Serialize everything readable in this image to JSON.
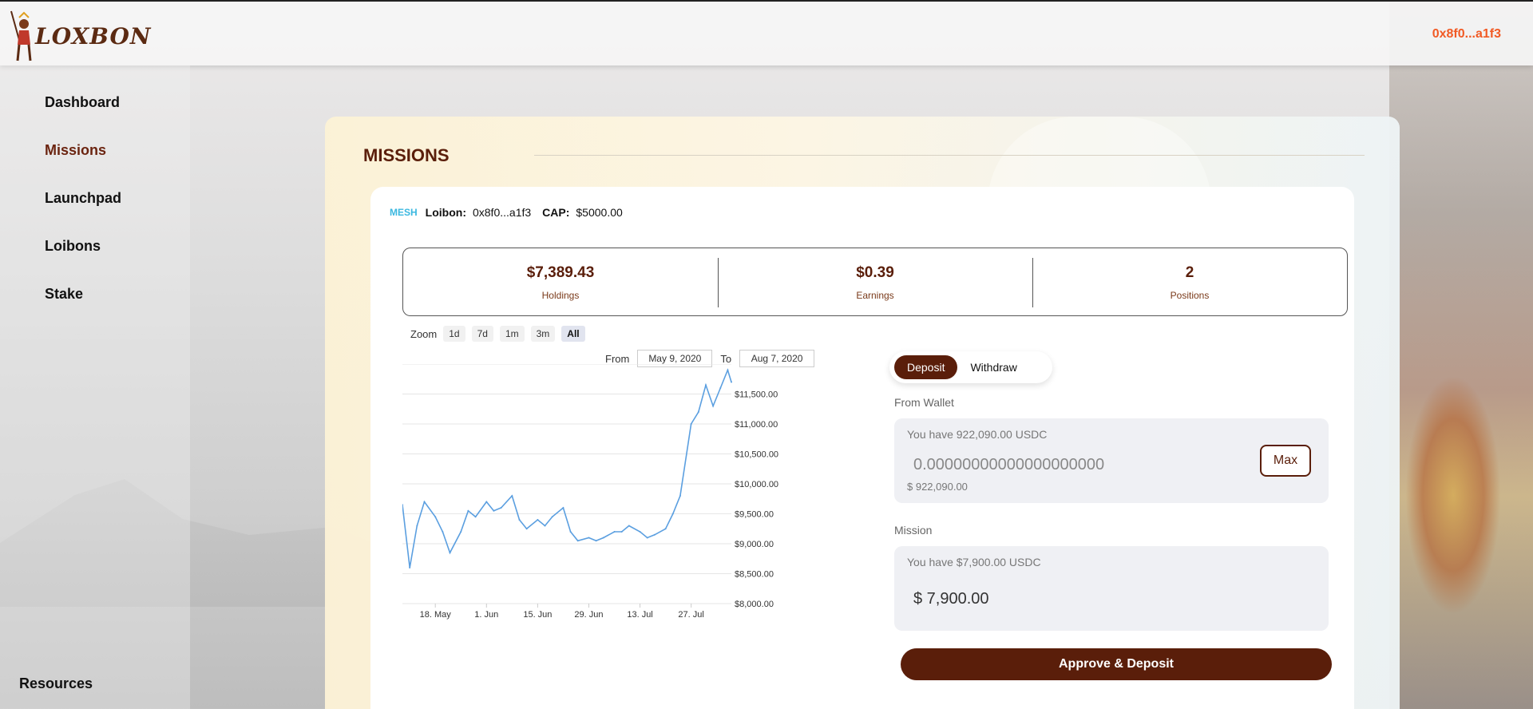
{
  "header": {
    "logo_text": "LOXBON",
    "wallet_address": "0x8f0...a1f3"
  },
  "sidebar": {
    "items": [
      {
        "label": "Dashboard",
        "active": false
      },
      {
        "label": "Missions",
        "active": true
      },
      {
        "label": "Launchpad",
        "active": false
      },
      {
        "label": "Loibons",
        "active": false
      },
      {
        "label": "Stake",
        "active": false
      }
    ],
    "resources_label": "Resources"
  },
  "main": {
    "title": "MISSIONS",
    "mission": {
      "badge": "MESH",
      "loibon_label": "Loibon:",
      "loibon_value": "0x8f0...a1f3",
      "cap_label": "CAP:",
      "cap_value": "$5000.00"
    },
    "stats": [
      {
        "value": "$7,389.43",
        "label": "Holdings"
      },
      {
        "value": "$0.39",
        "label": "Earnings"
      },
      {
        "value": "2",
        "label": "Positions"
      }
    ],
    "zoom": {
      "label": "Zoom",
      "options": [
        "1d",
        "7d",
        "1m",
        "3m",
        "All"
      ],
      "selected": "All"
    },
    "range": {
      "from_label": "From",
      "from_value": "May 9, 2020",
      "to_label": "To",
      "to_value": "Aug 7, 2020"
    },
    "deposit": {
      "tabs": [
        "Deposit",
        "Withdraw"
      ],
      "active_tab": "Deposit",
      "from_wallet_label": "From Wallet",
      "wallet_have": "You have 922,090.00 USDC",
      "wallet_amount": "0.00000000000000000000",
      "wallet_usd": "$ 922,090.00",
      "max_label": "Max",
      "mission_label": "Mission",
      "mission_have": "You have $7,900.00 USDC",
      "mission_amount": "$ 7,900.00",
      "approve_label": "Approve & Deposit"
    }
  },
  "colors": {
    "brand": "#5a1e0a",
    "accent": "#f15a24",
    "line": "#5b9fe0"
  },
  "chart_data": {
    "type": "line",
    "x": [
      "2020-05-09",
      "2020-05-11",
      "2020-05-13",
      "2020-05-15",
      "2020-05-18",
      "2020-05-20",
      "2020-05-22",
      "2020-05-25",
      "2020-05-27",
      "2020-05-29",
      "2020-06-01",
      "2020-06-03",
      "2020-06-05",
      "2020-06-08",
      "2020-06-10",
      "2020-06-12",
      "2020-06-15",
      "2020-06-17",
      "2020-06-19",
      "2020-06-22",
      "2020-06-24",
      "2020-06-26",
      "2020-06-29",
      "2020-07-01",
      "2020-07-03",
      "2020-07-06",
      "2020-07-08",
      "2020-07-10",
      "2020-07-13",
      "2020-07-15",
      "2020-07-17",
      "2020-07-20",
      "2020-07-22",
      "2020-07-24",
      "2020-07-27",
      "2020-07-29",
      "2020-07-31",
      "2020-08-02",
      "2020-08-04",
      "2020-08-06",
      "2020-08-07"
    ],
    "values": [
      9650,
      8600,
      9300,
      9700,
      9450,
      9200,
      8850,
      9200,
      9550,
      9450,
      9700,
      9550,
      9600,
      9800,
      9400,
      9250,
      9400,
      9300,
      9450,
      9600,
      9200,
      9050,
      9100,
      9050,
      9100,
      9200,
      9200,
      9300,
      9200,
      9100,
      9150,
      9250,
      9500,
      9800,
      11000,
      11200,
      11650,
      11300,
      11600,
      11900,
      11700
    ],
    "categories": [
      "18. May",
      "1. Jun",
      "15. Jun",
      "29. Jun",
      "13. Jul",
      "27. Jul"
    ],
    "y_ticks": [
      "$8,000.00",
      "$8,500.00",
      "$9,000.00",
      "$9,500.00",
      "$10,000.00",
      "$10,500.00",
      "$11,000.00",
      "$11,500.00"
    ],
    "ylim": [
      8000,
      12000
    ],
    "grid": true
  }
}
